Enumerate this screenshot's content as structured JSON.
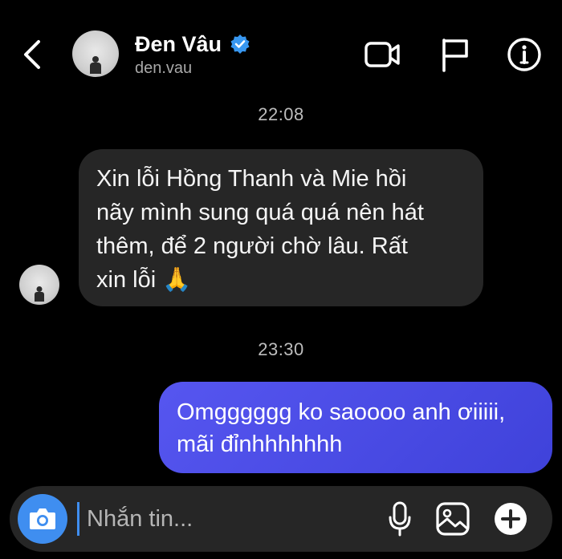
{
  "header": {
    "name": "Đen Vâu",
    "username": "den.vau",
    "verified": true,
    "back_icon": "chevron-left-icon",
    "actions": [
      "video-camera-icon",
      "flag-icon",
      "info-icon"
    ]
  },
  "messages": [
    {
      "timestamp": "22:08",
      "direction": "incoming",
      "lines": [
        "Xin lỗi Hồng Thanh và Mie hồi",
        "nãy mình sung quá quá nên hát",
        "thêm, để 2 người chờ lâu. Rất",
        "xin lỗi 🙏"
      ]
    },
    {
      "timestamp": "23:30",
      "direction": "outgoing",
      "lines": [
        "Omgggggg ko saoooo anh ơiiiii,",
        "mãi đỉnhhhhhhh"
      ]
    }
  ],
  "composer": {
    "placeholder": "Nhắn tin...",
    "value": "",
    "icons": [
      "camera-icon",
      "microphone-icon",
      "image-icon",
      "plus-icon"
    ]
  },
  "colors": {
    "background": "#000000",
    "incoming_bubble": "#262626",
    "outgoing_bubble": "#4c4ee8",
    "accent": "#3f8ef0",
    "verified": "#3897f0"
  }
}
